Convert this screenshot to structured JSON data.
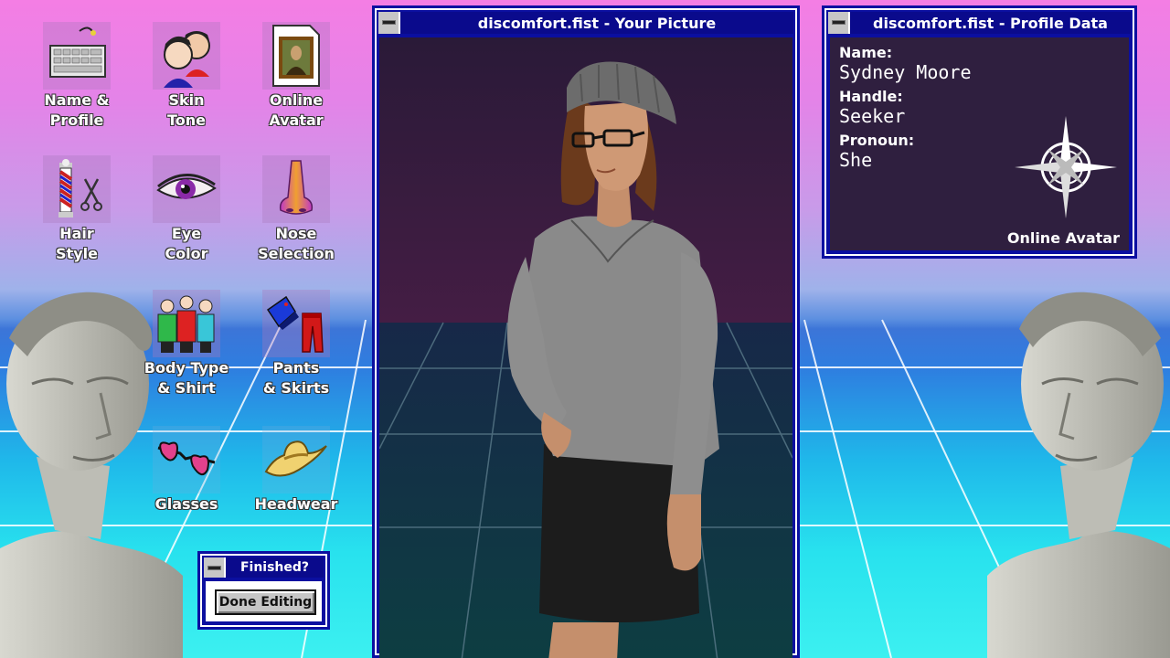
{
  "colors": {
    "window_blue": "#0b0fa0",
    "title_blue": "#0a0a8c",
    "panel_purple": "#2f1f3f"
  },
  "icons": [
    {
      "label": "Name &\nProfile",
      "icon": "keyboard-icon"
    },
    {
      "label": "Skin\nTone",
      "icon": "faces-icon"
    },
    {
      "label": "Online\nAvatar",
      "icon": "portrait-file-icon"
    },
    {
      "label": "Hair\nStyle",
      "icon": "barber-pole-scissors-icon"
    },
    {
      "label": "Eye\nColor",
      "icon": "eye-icon"
    },
    {
      "label": "Nose\nSelection",
      "icon": "nose-icon"
    },
    {
      "label": "Body Type\n& Shirt",
      "icon": "people-shirts-icon"
    },
    {
      "label": "Pants\n& Skirts",
      "icon": "pants-icon"
    },
    {
      "label": "Glasses",
      "icon": "glasses-icon"
    },
    {
      "label": "Headwear",
      "icon": "cowboy-hat-icon"
    }
  ],
  "finished": {
    "title": "Finished?",
    "button": "Done Editing"
  },
  "picture_window": {
    "title": "discomfort.fist - Your Picture"
  },
  "profile_window": {
    "title": "discomfort.fist - Profile Data",
    "name_label": "Name:",
    "name_value": "Sydney Moore",
    "handle_label": "Handle:",
    "handle_value": "Seeker",
    "pronoun_label": "Pronoun:",
    "pronoun_value": "She",
    "avatar_label": "Online Avatar"
  }
}
